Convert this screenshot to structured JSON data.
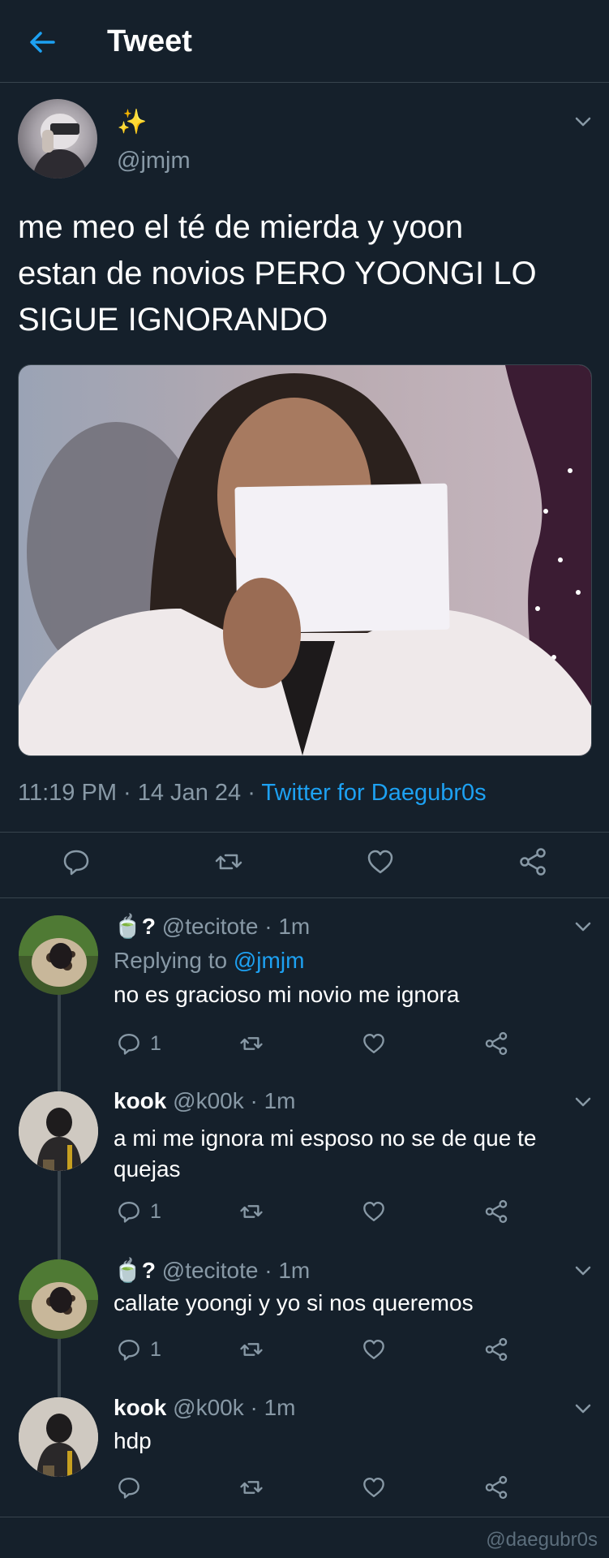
{
  "header": {
    "title": "Tweet"
  },
  "tweet": {
    "display_name": "✨",
    "handle": "@jmjm",
    "text_line1": "me meo el té de mierda y yoon",
    "text_line2": "estan de novios PERO YOONGI LO",
    "text_line3": "SIGUE IGNORANDO",
    "meta_time": "11:19 PM · 14 Jan 24 · ",
    "meta_source": "Twitter for Daegubr0s"
  },
  "replies": [
    {
      "emoji": "🍵",
      "name": "?",
      "handle": "@tecitote",
      "time": "· 1m",
      "replying_prefix": "Replying to ",
      "replying_handle": "@jmjm",
      "text": "no es gracioso mi novio me ignora",
      "reply_count": "1"
    },
    {
      "name": "kook",
      "handle": "@k00k",
      "time": "· 1m",
      "text_line1": "a mi me ignora mi esposo no se de que te",
      "text_line2": "quejas",
      "reply_count": "1"
    },
    {
      "emoji": "🍵",
      "name": "?",
      "handle": "@tecitote",
      "time": "· 1m",
      "text": "callate yoongi y yo si nos queremos",
      "reply_count": "1"
    },
    {
      "name": "kook",
      "handle": "@k00k",
      "time": "· 1m",
      "text": "hdp"
    }
  ],
  "watermark": "@daegubr0s",
  "colors": {
    "background": "#15202b",
    "accent": "#1da1f2",
    "muted": "#8899a6",
    "divider": "#38444d"
  }
}
